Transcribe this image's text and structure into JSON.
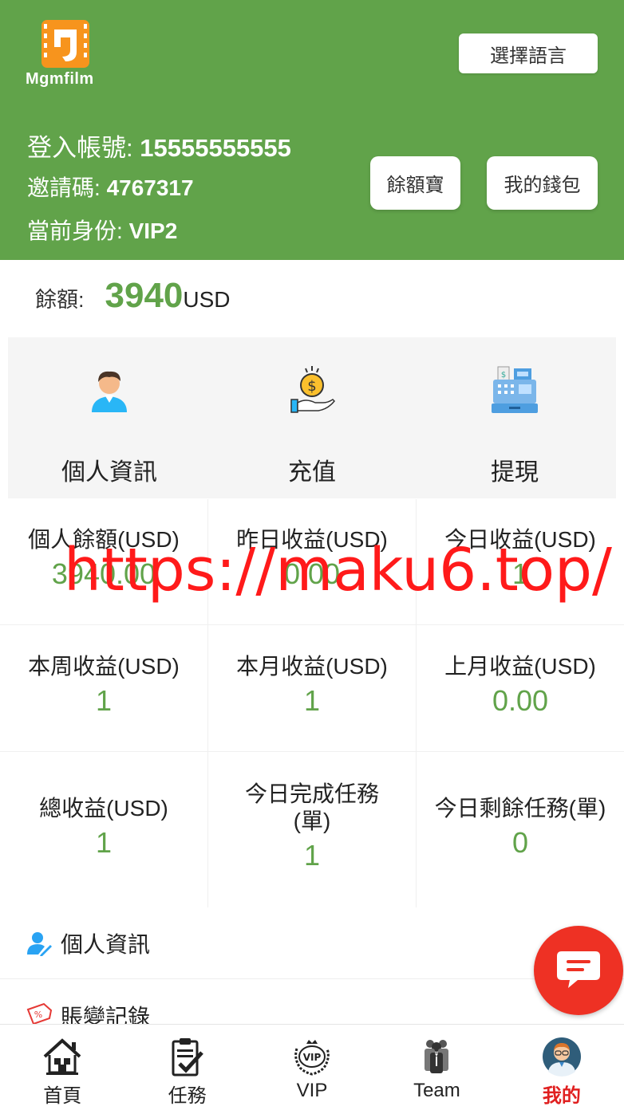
{
  "app": {
    "logo_text": "Mgmfilm"
  },
  "header": {
    "language_button": "選擇語言",
    "account_label": "登入帳號:",
    "account_value": "15555555555",
    "invite_label": "邀請碼:",
    "invite_value": "4767317",
    "identity_label": "當前身份:",
    "identity_value": "VIP2",
    "yuebao_button": "餘額寶",
    "wallet_button": "我的錢包"
  },
  "balance": {
    "label": "餘額:",
    "value": "3940",
    "unit": "USD"
  },
  "actions": [
    {
      "label": "個人資訊",
      "icon": "profile-person-icon"
    },
    {
      "label": "充值",
      "icon": "recharge-coin-hand-icon"
    },
    {
      "label": "提現",
      "icon": "withdraw-cash-register-icon"
    }
  ],
  "stats": [
    {
      "title": "個人餘額(USD)",
      "value": "3940.00"
    },
    {
      "title": "昨日收益(USD)",
      "value": "0.00"
    },
    {
      "title": "今日收益(USD)",
      "value": "1"
    },
    {
      "title": "本周收益(USD)",
      "value": "1"
    },
    {
      "title": "本月收益(USD)",
      "value": "1"
    },
    {
      "title": "上月收益(USD)",
      "value": "0.00"
    },
    {
      "title": "總收益(USD)",
      "value": "1"
    },
    {
      "title": "今日完成任務(單)",
      "value": "1"
    },
    {
      "title": "今日剩餘任務(單)",
      "value": "0"
    }
  ],
  "list": [
    {
      "label": "個人資訊",
      "icon": "user-edit-icon"
    },
    {
      "label": "賬變記錄",
      "icon": "discount-tag-icon"
    }
  ],
  "watermark": "https://maku6.top/",
  "tabs": [
    {
      "label": "首頁",
      "icon": "home-icon"
    },
    {
      "label": "任務",
      "icon": "task-clipboard-icon"
    },
    {
      "label": "VIP",
      "icon": "vip-badge-icon"
    },
    {
      "label": "Team",
      "icon": "team-icon"
    },
    {
      "label": "我的",
      "icon": "avatar-icon"
    }
  ],
  "colors": {
    "brand_green": "#61a34a",
    "active_tab": "#e02020",
    "chat_fab": "#ee3124",
    "watermark": "#ff1a1a"
  }
}
